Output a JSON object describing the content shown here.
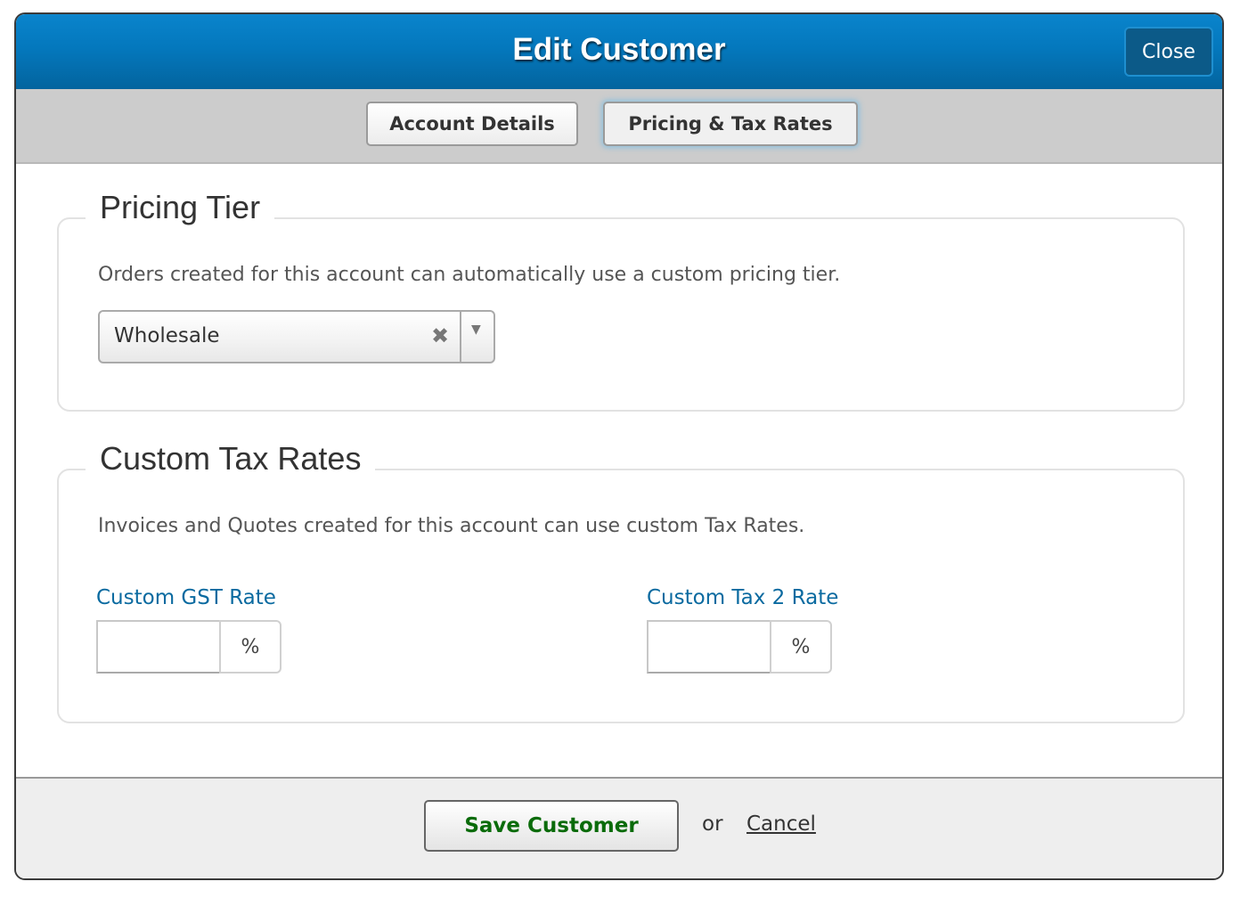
{
  "header": {
    "title": "Edit Customer",
    "close_label": "Close"
  },
  "tabs": [
    {
      "label": "Account Details",
      "active": false
    },
    {
      "label": "Pricing & Tax Rates",
      "active": true
    }
  ],
  "pricing_tier": {
    "legend": "Pricing Tier",
    "description": "Orders created for this account can automatically use a custom pricing tier.",
    "select_value": "Wholesale",
    "clear_glyph": "✖",
    "arrow_glyph": "▼"
  },
  "tax_rates": {
    "legend": "Custom Tax Rates",
    "description": "Invoices and Quotes created for this account can use custom Tax Rates.",
    "fields": [
      {
        "label": "Custom GST Rate",
        "value": "",
        "suffix": "%"
      },
      {
        "label": "Custom Tax 2 Rate",
        "value": "",
        "suffix": "%"
      }
    ]
  },
  "footer": {
    "save_label": "Save Customer",
    "or_text": "or",
    "cancel_label": "Cancel"
  },
  "colors": {
    "header_blue": "#0478bd",
    "label_blue": "#0a6aa0",
    "save_green": "#0a6b0a"
  }
}
